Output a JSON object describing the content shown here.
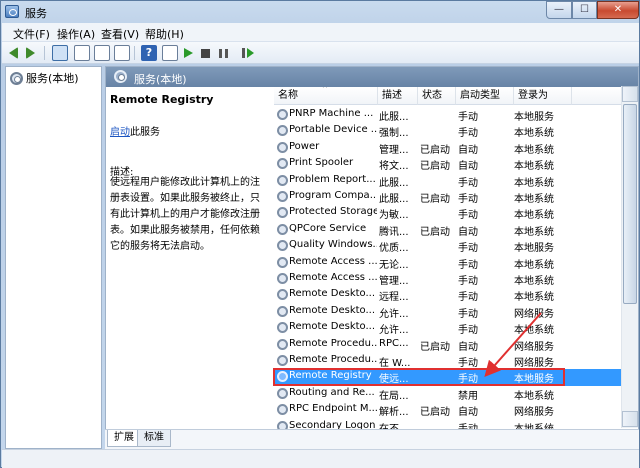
{
  "window": {
    "title": "服务"
  },
  "menu": [
    "文件(F)",
    "操作(A)",
    "查看(V)",
    "帮助(H)"
  ],
  "tree": {
    "root_label": "服务(本地)"
  },
  "pane": {
    "header_title": "服务(本地)"
  },
  "detail": {
    "service_name": "Remote Registry",
    "start_link": "启动",
    "start_suffix": "此服务",
    "desc_label": "描述:",
    "desc_text": "使远程用户能修改此计算机上的注册表设置。如果此服务被终止，只有此计算机上的用户才能修改注册表。如果此服务被禁用，任何依赖它的服务将无法启动。"
  },
  "columns": [
    "名称",
    "描述",
    "状态",
    "启动类型",
    "登录为"
  ],
  "services": [
    {
      "name": "PNRP Machine ...",
      "desc": "此服...",
      "status": "",
      "startup": "手动",
      "logon": "本地服务"
    },
    {
      "name": "Portable Device ...",
      "desc": "强制...",
      "status": "",
      "startup": "手动",
      "logon": "本地系统"
    },
    {
      "name": "Power",
      "desc": "管理...",
      "status": "已启动",
      "startup": "自动",
      "logon": "本地系统"
    },
    {
      "name": "Print Spooler",
      "desc": "将文...",
      "status": "已启动",
      "startup": "自动",
      "logon": "本地系统"
    },
    {
      "name": "Problem Report...",
      "desc": "此服...",
      "status": "",
      "startup": "手动",
      "logon": "本地系统"
    },
    {
      "name": "Program Compa...",
      "desc": "此服...",
      "status": "已启动",
      "startup": "手动",
      "logon": "本地系统"
    },
    {
      "name": "Protected Storage",
      "desc": "为敏...",
      "status": "",
      "startup": "手动",
      "logon": "本地系统"
    },
    {
      "name": "QPCore Service",
      "desc": "腾讯...",
      "status": "已启动",
      "startup": "自动",
      "logon": "本地系统"
    },
    {
      "name": "Quality Windows...",
      "desc": "优质...",
      "status": "",
      "startup": "手动",
      "logon": "本地服务"
    },
    {
      "name": "Remote Access ...",
      "desc": "无论...",
      "status": "",
      "startup": "手动",
      "logon": "本地系统"
    },
    {
      "name": "Remote Access ...",
      "desc": "管理...",
      "status": "",
      "startup": "手动",
      "logon": "本地系统"
    },
    {
      "name": "Remote Deskto...",
      "desc": "远程...",
      "status": "",
      "startup": "手动",
      "logon": "本地系统"
    },
    {
      "name": "Remote Deskto...",
      "desc": "允许...",
      "status": "",
      "startup": "手动",
      "logon": "网络服务"
    },
    {
      "name": "Remote Deskto...",
      "desc": "允许...",
      "status": "",
      "startup": "手动",
      "logon": "本地系统"
    },
    {
      "name": "Remote Procedu...",
      "desc": "RPC...",
      "status": "已启动",
      "startup": "自动",
      "logon": "网络服务"
    },
    {
      "name": "Remote Procedu...",
      "desc": "在 W...",
      "status": "",
      "startup": "手动",
      "logon": "网络服务"
    },
    {
      "name": "Remote Registry",
      "desc": "使远...",
      "status": "",
      "startup": "手动",
      "logon": "本地服务",
      "selected": true
    },
    {
      "name": "Routing and Re...",
      "desc": "在局...",
      "status": "",
      "startup": "禁用",
      "logon": "本地系统"
    },
    {
      "name": "RPC Endpoint M...",
      "desc": "解析...",
      "status": "已启动",
      "startup": "自动",
      "logon": "网络服务"
    },
    {
      "name": "Secondary Logon",
      "desc": "在不...",
      "status": "",
      "startup": "手动",
      "logon": "本地系统"
    }
  ],
  "tabs": [
    "扩展",
    "标准"
  ],
  "annotation_color": "#e03030",
  "selection_color": "#3399ff"
}
